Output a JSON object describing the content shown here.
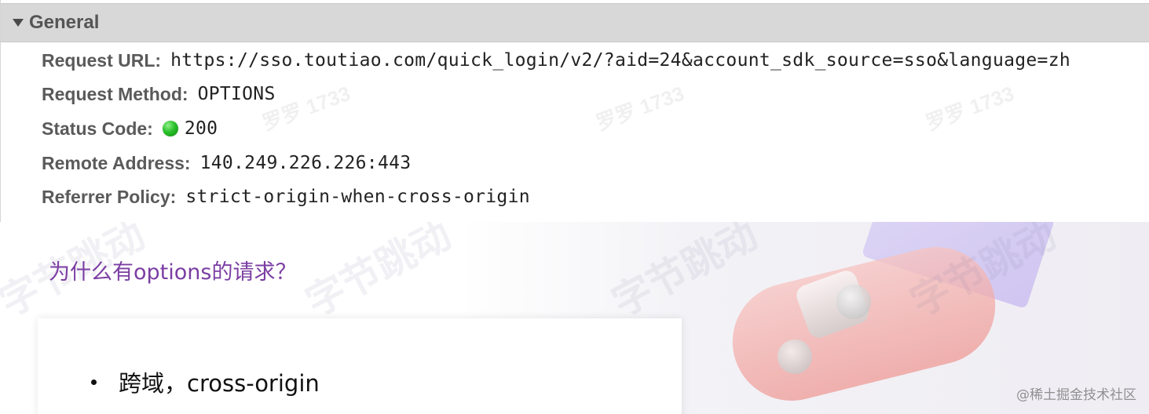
{
  "general": {
    "title": "General",
    "rows": [
      {
        "key": "Request URL:",
        "value": "https://sso.toutiao.com/quick_login/v2/?aid=24&account_sdk_source=sso&language=zh"
      },
      {
        "key": "Request Method:",
        "value": "OPTIONS"
      },
      {
        "key": "Status Code:",
        "value": "200",
        "status_color": "#22b422"
      },
      {
        "key": "Remote Address:",
        "value": "140.249.226.226:443"
      },
      {
        "key": "Referrer Policy:",
        "value": "strict-origin-when-cross-origin"
      }
    ]
  },
  "watermarks": {
    "name": "罗罗 1733",
    "brand": "字节跳动"
  },
  "slide": {
    "heading": "为什么有options的请求？",
    "heading_color": "#7b3ea3",
    "bullets": [
      {
        "text": "跨域，cross-origin"
      }
    ],
    "credit": "@稀土掘金技术社区"
  }
}
